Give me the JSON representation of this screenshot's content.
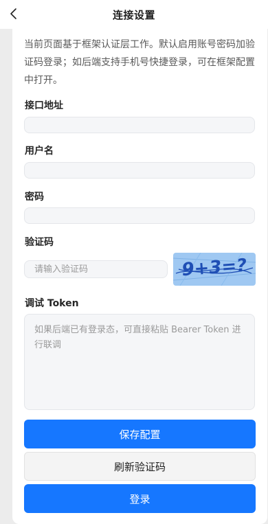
{
  "header": {
    "title": "连接设置",
    "back_icon": "chevron-left-icon"
  },
  "intro": "当前页面基于框架认证层工作。默认启用账号密码加验证码登录；如后端支持手机号快捷登录，可在框架配置中打开。",
  "fields": {
    "api_url": {
      "label": "接口地址",
      "value": ""
    },
    "username": {
      "label": "用户名",
      "value": ""
    },
    "password": {
      "label": "密码",
      "value": ""
    },
    "captcha": {
      "label": "验证码",
      "placeholder": "请输入验证码",
      "image_text": "9+3=?"
    },
    "token": {
      "label": "调试 Token",
      "placeholder": "如果后端已有登录态，可直接粘贴 Bearer Token 进行联调"
    }
  },
  "buttons": {
    "save": "保存配置",
    "refresh_captcha": "刷新验证码",
    "login": "登录"
  },
  "colors": {
    "primary": "#1677ff",
    "captcha_bg": "#9fc8f2",
    "captcha_text": "#1f4fb5"
  }
}
